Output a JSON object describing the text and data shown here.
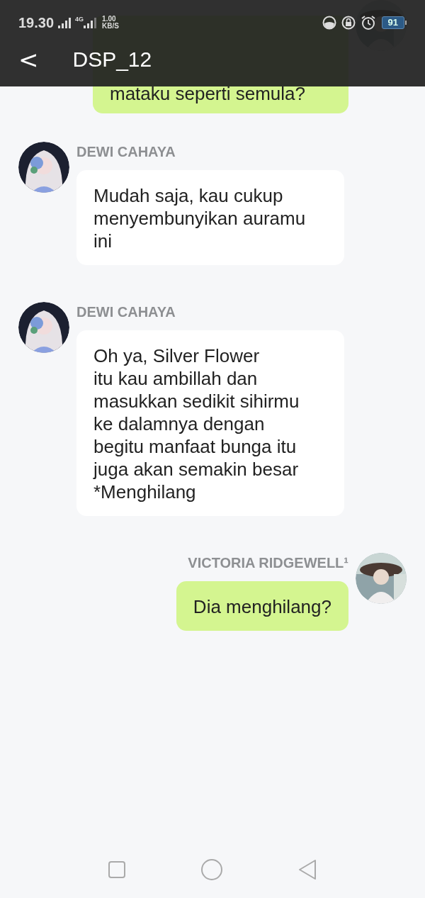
{
  "status_bar": {
    "time": "19.30",
    "network": "4G",
    "speed": "1.00",
    "speed_unit": "KB/S",
    "battery": "91"
  },
  "header": {
    "back": "<",
    "title": "DSP_12"
  },
  "messages": [
    {
      "kind": "outgoing",
      "text": "mataku seperti semula?"
    },
    {
      "kind": "incoming",
      "sender": "DEWI CAHAYA",
      "text": "Mudah saja, kau cukup menyembunyikan auramu ini"
    },
    {
      "kind": "incoming",
      "sender": "DEWI CAHAYA",
      "text": "Oh ya, Silver Flower\nitu kau ambillah dan masukkan sedikit sihirmu ke dalamnya dengan begitu manfaat bunga itu juga akan semakin besar *Menghilang"
    },
    {
      "kind": "outgoing",
      "sender": "VICTORIA RIDGEWELL¹",
      "text": "Dia menghilang?"
    }
  ]
}
